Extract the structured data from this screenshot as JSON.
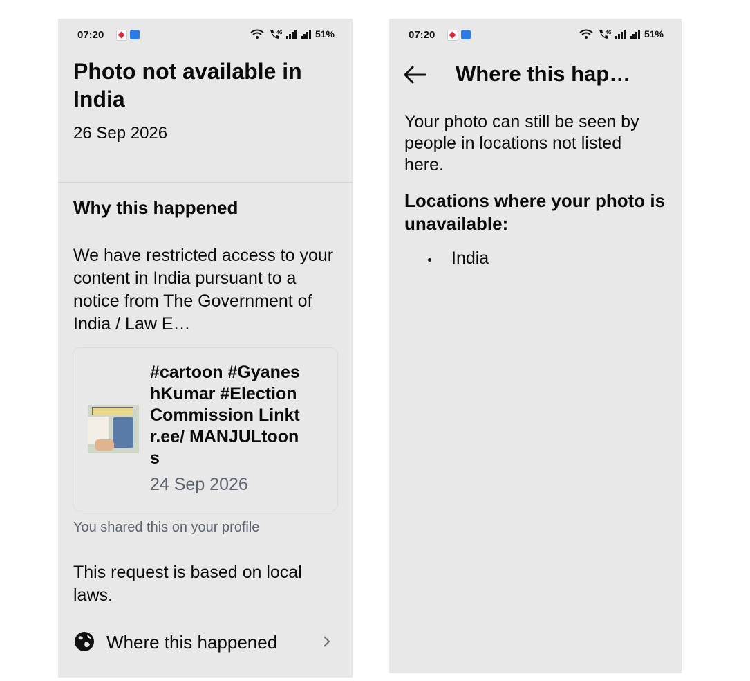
{
  "status": {
    "time": "07:20",
    "battery": "51%"
  },
  "left": {
    "title": "Photo not available in India",
    "date": "26 Sep 2026",
    "section_heading": "Why this happened",
    "body": "We have restricted access to your content in India pursuant to a notice from The Government of India / Law E…",
    "post": {
      "caption": "#cartoon #GyaneshKumar #ElectionCommission Linktr.ee/ MANJULtoons",
      "date": "24 Sep 2026"
    },
    "shared_note": "You shared this on your profile",
    "local_laws": "This request is based on local laws.",
    "where_label": "Where this happened"
  },
  "right": {
    "header_title": "Where this hap…",
    "body": "Your photo can still be seen by people in locations not listed here.",
    "list_heading": "Locations where your photo is unavailable:",
    "locations": [
      "India"
    ]
  },
  "icons": {
    "back": "back-arrow-icon",
    "globe": "globe-icon",
    "chevron": "chevron-right-icon",
    "wifi": "wifi-icon",
    "call": "volte-call-icon",
    "signal": "signal-icon"
  }
}
